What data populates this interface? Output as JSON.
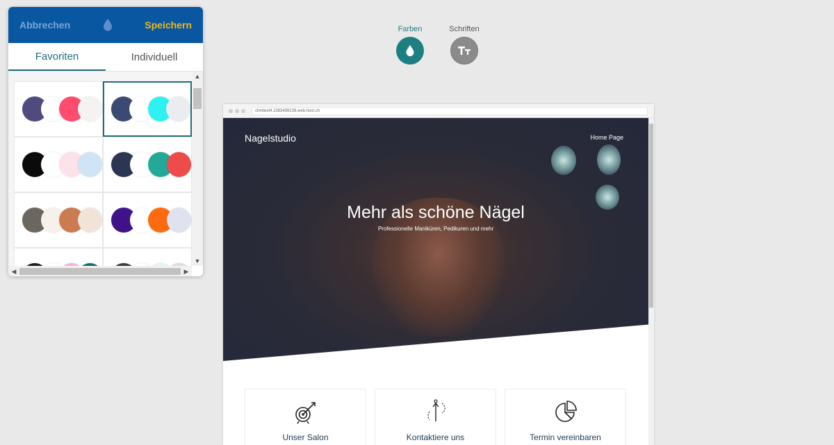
{
  "panel": {
    "cancel_label": "Abbrechen",
    "save_label": "Speichern",
    "tabs": [
      {
        "label": "Favoriten",
        "active": true
      },
      {
        "label": "Individuell",
        "active": false
      }
    ],
    "palettes": [
      {
        "colors": [
          "#4f4b7e",
          "#ffffff",
          "#ff4b6e",
          "#f4f3f1"
        ],
        "selected": false
      },
      {
        "colors": [
          "#3b4a72",
          "#ffffff",
          "#2ef2f2",
          "#e9edf0"
        ],
        "selected": true
      },
      {
        "colors": [
          "#0b0b0b",
          "#ffffff",
          "#fde2ea",
          "#cfe4f5"
        ],
        "selected": false
      },
      {
        "colors": [
          "#2c3552",
          "#ffffff",
          "#22a99a",
          "#ef4b4b"
        ],
        "selected": false
      },
      {
        "colors": [
          "#6b6660",
          "#f6f1ea",
          "#cc7a52",
          "#f0e4d8"
        ],
        "selected": false
      },
      {
        "colors": [
          "#3f1289",
          "#ffffff",
          "#ff6a0e",
          "#e1e2ef"
        ],
        "selected": false
      },
      {
        "colors": [
          "#1f1f1f",
          "#ffffff",
          "#f6b3d8",
          "#0f6f6f"
        ],
        "selected": false
      },
      {
        "colors": [
          "#3a3a3a",
          "#ffffff",
          "#e0f6f0",
          "#dddddd"
        ],
        "selected": false
      }
    ],
    "accent": "#0a57a1",
    "save_color": "#f2b817"
  },
  "toggles": {
    "colors_label": "Farben",
    "fonts_label": "Schriften",
    "active": "Farben"
  },
  "preview": {
    "url": "chmtest4.1583499139.web.host.ch",
    "brand": "Nagelstudio",
    "nav_link": "Home Page",
    "hero_title": "Mehr als schöne Nägel",
    "hero_subtitle": "Professionelle Maniküren, Pedikuren und mehr",
    "features": [
      {
        "label": "Unser Salon",
        "icon": "target-icon"
      },
      {
        "label": "Kontaktiere uns",
        "icon": "direction-icon"
      },
      {
        "label": "Termin vereinbaren",
        "icon": "pie-chart-icon"
      }
    ]
  }
}
